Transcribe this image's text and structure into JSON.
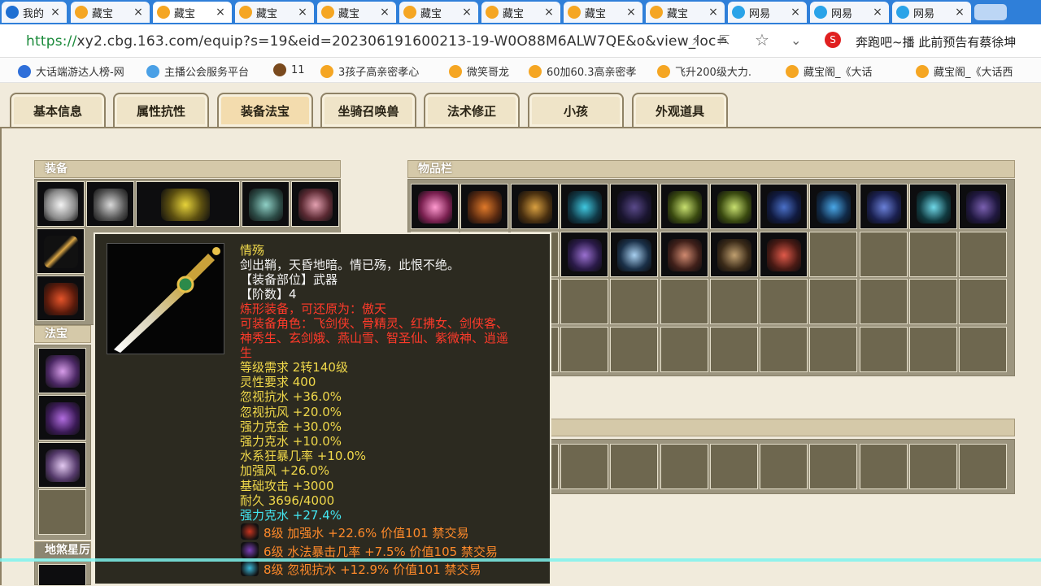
{
  "browser": {
    "tabs": [
      {
        "label": "我的",
        "icon": "sogou-icon"
      },
      {
        "label": "藏宝",
        "icon": "chick-icon"
      },
      {
        "label": "藏宝",
        "icon": "chick-icon",
        "active": true
      },
      {
        "label": "藏宝",
        "icon": "chick-icon"
      },
      {
        "label": "藏宝",
        "icon": "chick-icon"
      },
      {
        "label": "藏宝",
        "icon": "chick-icon"
      },
      {
        "label": "藏宝",
        "icon": "chick-icon"
      },
      {
        "label": "藏宝",
        "icon": "chick-icon"
      },
      {
        "label": "藏宝",
        "icon": "chick-icon"
      },
      {
        "label": "网易",
        "icon": "netease-icon"
      },
      {
        "label": "网易",
        "icon": "netease-icon"
      },
      {
        "label": "网易",
        "icon": "netease-icon"
      }
    ],
    "url_scheme": "https://",
    "url_rest": "xy2.cbg.163.com/equip?s=19&eid=202306191600213-19-W0O88M6ALW7QE&o&view_loc=",
    "news_ticker": "奔跑吧~播 此前预告有蔡徐坤",
    "bookmarks": [
      "大话端游达人榜-网",
      "主播公会服务平台",
      "11",
      "3孩子高亲密孝心",
      "微笑哥龙",
      "60加60.3高亲密孝",
      "飞升200级大力.",
      "藏宝阁_《大话",
      "藏宝阁_《大话西"
    ]
  },
  "game_tabs": [
    "基本信息",
    "属性抗性",
    "装备法宝",
    "坐骑召唤兽",
    "法术修正",
    "小孩",
    "外观道具"
  ],
  "active_tab": "装备法宝",
  "panels": {
    "equipment": "装备",
    "treasure": "法宝",
    "inventory": "物品栏",
    "star": "地煞星厉"
  },
  "tooltip": {
    "name": "情殇",
    "description": "剑出鞘，天昏地暗。情已殇，此恨不绝。",
    "slot": "【装备部位】武器",
    "tier": "【阶数】4",
    "refine_note": "炼形装备，可还原为：傲天",
    "roles_line1": "可装备角色：飞剑侠、骨精灵、红拂女、剑侠客、",
    "roles_line2": "神秀生、玄剑娥、燕山雪、智圣仙、紫微神、逍遥",
    "roles_line3": "生",
    "stats": [
      "等级需求 2转140级",
      "灵性要求 400",
      "忽视抗水 +36.0%",
      "忽视抗风 +20.0%",
      "强力克金 +30.0%",
      "强力克水 +10.0%",
      "水系狂暴几率 +10.0%",
      "加强风 +26.0%",
      "基础攻击 +3000",
      "耐久 3696/4000"
    ],
    "extra_stat": "强力克水 +27.4%",
    "gems": [
      {
        "text": "8级 加强水 +22.6% 价值101 禁交易",
        "color": "#c8341f"
      },
      {
        "text": "6级 水法暴击几率 +7.5% 价值105 禁交易",
        "color": "#7b3fb8"
      },
      {
        "text": "8级 忽视抗水 +12.9% 价值101 禁交易",
        "color": "#3bb7d8"
      }
    ]
  }
}
